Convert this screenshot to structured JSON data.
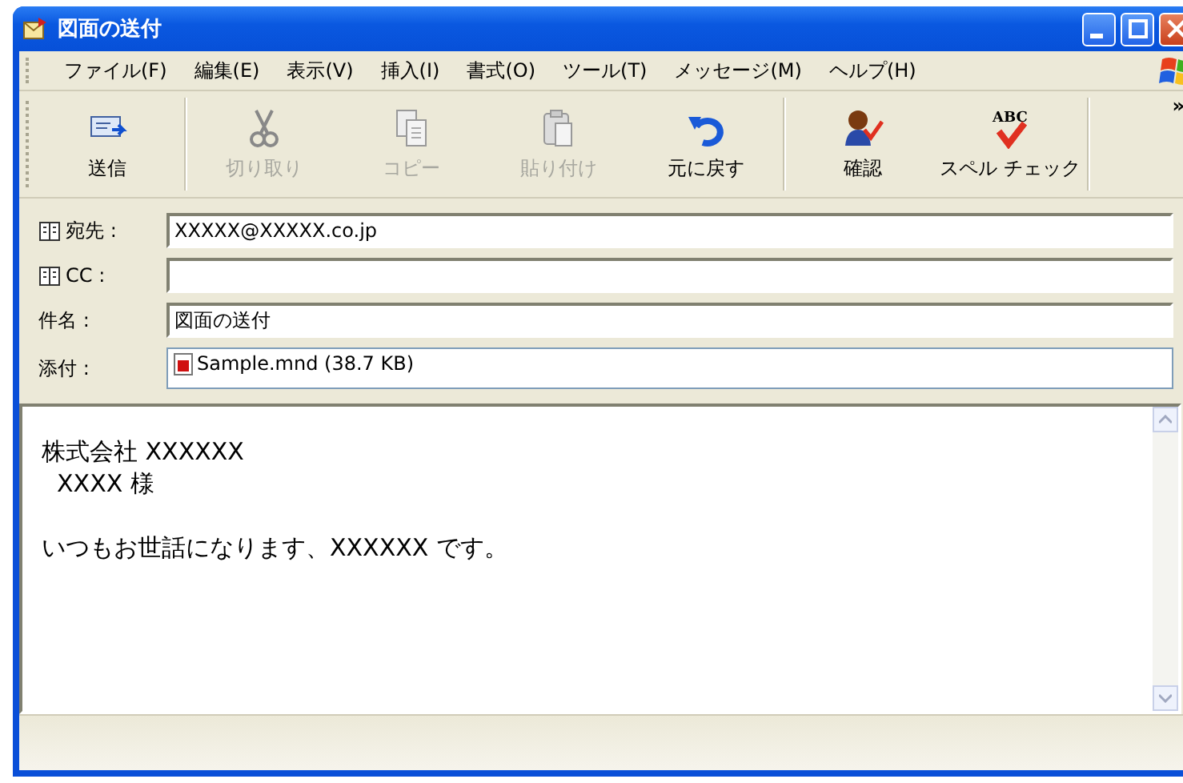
{
  "window": {
    "title": "図面の送付"
  },
  "menu": [
    "ファイル(F)",
    "編集(E)",
    "表示(V)",
    "挿入(I)",
    "書式(O)",
    "ツール(T)",
    "メッセージ(M)",
    "ヘルプ(H)"
  ],
  "toolbar": [
    {
      "kind": "send",
      "label": "送信",
      "disabled": false
    },
    {
      "kind": "cut",
      "label": "切り取り",
      "disabled": true
    },
    {
      "kind": "copy",
      "label": "コピー",
      "disabled": true
    },
    {
      "kind": "paste",
      "label": "貼り付け",
      "disabled": true
    },
    {
      "kind": "undo",
      "label": "元に戻す",
      "disabled": false
    },
    {
      "kind": "check",
      "label": "確認",
      "disabled": false
    },
    {
      "kind": "spell",
      "label": "スペル チェック",
      "icon_text": "ABC",
      "disabled": false
    }
  ],
  "toolbar_overflow": "»",
  "fields": [
    {
      "kind": "address",
      "label": "宛先 :",
      "value": "XXXXX@XXXXX.co.jp"
    },
    {
      "kind": "address",
      "label": "CC :"
    },
    {
      "kind": "text",
      "label": "件名 :",
      "value": "図面の送付"
    },
    {
      "kind": "attachment",
      "label": "添付 :",
      "value": "Sample.mnd (38.7 KB)"
    }
  ],
  "body": [
    [
      "株式会社 XXXXXX",
      "  XXXX 様"
    ],
    [
      "いつもお世話になります、XXXXXX です。"
    ]
  ]
}
